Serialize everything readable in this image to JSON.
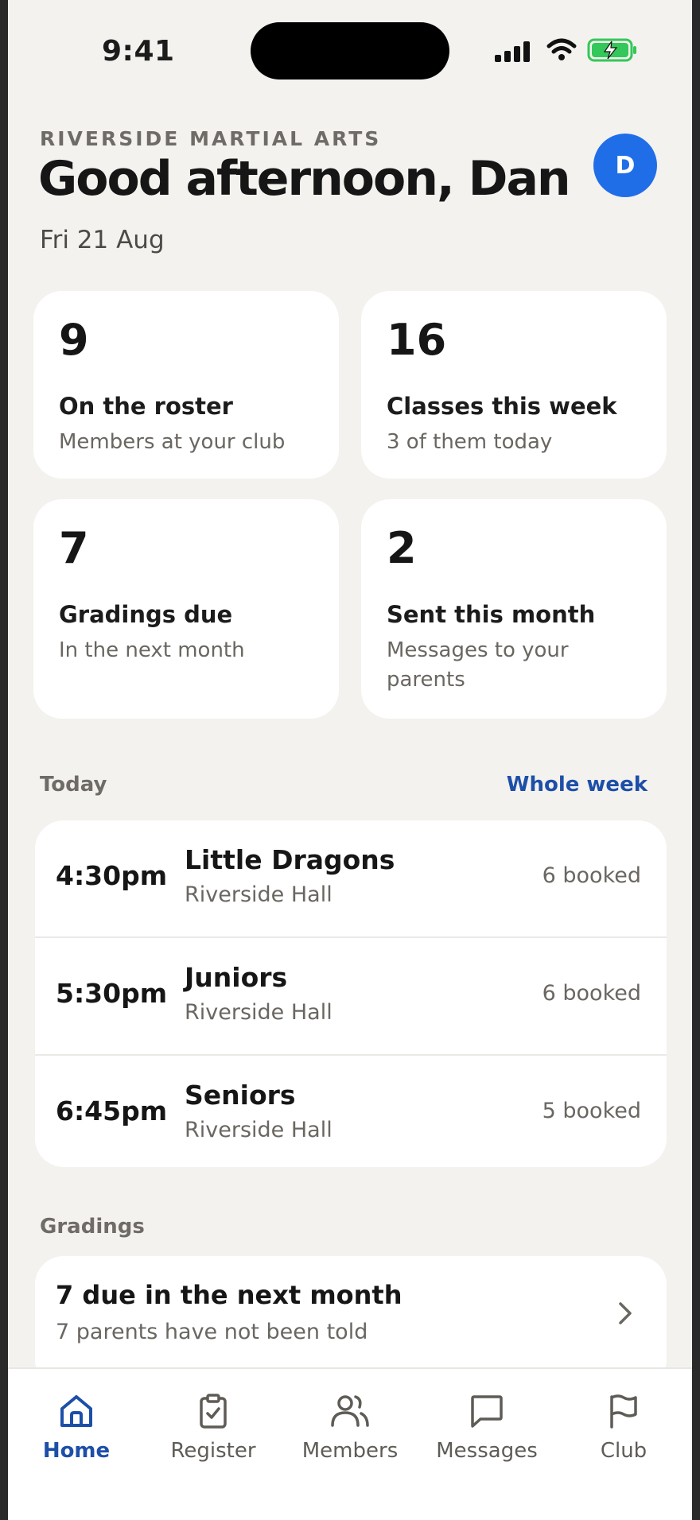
{
  "status_bar": {
    "time": "9:41"
  },
  "header": {
    "club_name": "RIVERSIDE MARTIAL ARTS",
    "greeting": "Good afternoon, Dan",
    "date": "Fri 21 Aug",
    "avatar_initial": "D"
  },
  "stats": [
    {
      "value": "9",
      "label": "On the roster",
      "sub": "Members at your club"
    },
    {
      "value": "16",
      "label": "Classes this week",
      "sub": "3 of them today"
    },
    {
      "value": "7",
      "label": "Gradings due",
      "sub": "In the next month"
    },
    {
      "value": "2",
      "label": "Sent this month",
      "sub": "Messages to your parents"
    }
  ],
  "today": {
    "title": "Today",
    "link": "Whole week",
    "classes": [
      {
        "time": "4:30pm",
        "name": "Little Dragons",
        "venue": "Riverside Hall",
        "booked": "6 booked"
      },
      {
        "time": "5:30pm",
        "name": "Juniors",
        "venue": "Riverside Hall",
        "booked": "6 booked"
      },
      {
        "time": "6:45pm",
        "name": "Seniors",
        "venue": "Riverside Hall",
        "booked": "5 booked"
      }
    ]
  },
  "gradings": {
    "title": "Gradings",
    "main": "7 due in the next month",
    "sub": "7 parents have not been told"
  },
  "tabs": [
    {
      "label": "Home",
      "icon": "home-icon",
      "active": true
    },
    {
      "label": "Register",
      "icon": "clipboard-check-icon",
      "active": false
    },
    {
      "label": "Members",
      "icon": "users-icon",
      "active": false
    },
    {
      "label": "Messages",
      "icon": "message-square-icon",
      "active": false
    },
    {
      "label": "Club",
      "icon": "flag-icon",
      "active": false
    }
  ],
  "colors": {
    "accent": "#1f6ee8",
    "link": "#1d4fa8",
    "background": "#f3f2ef",
    "battery": "#34c759"
  }
}
